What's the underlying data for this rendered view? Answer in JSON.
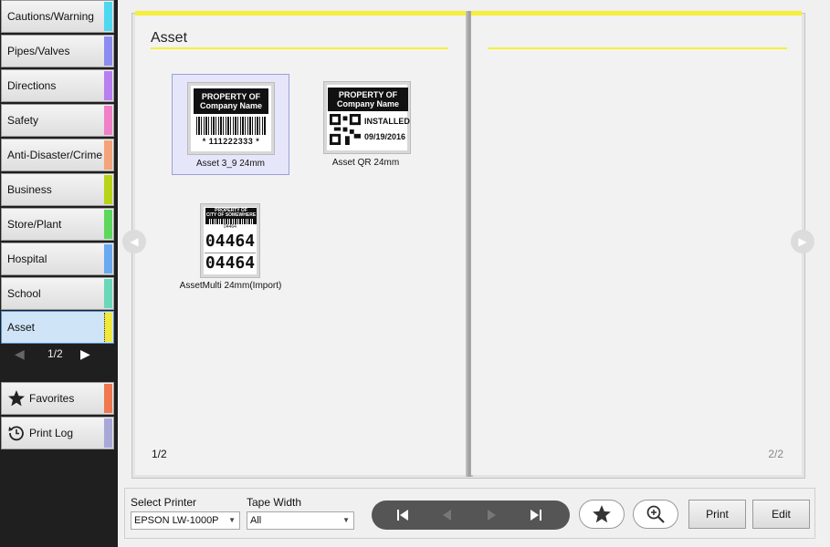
{
  "sidebar": {
    "categories": [
      {
        "label": "Cautions/Warning",
        "color": "#4dd8f0"
      },
      {
        "label": "Pipes/Valves",
        "color": "#8c8cf0"
      },
      {
        "label": "Directions",
        "color": "#b87ff0"
      },
      {
        "label": "Safety",
        "color": "#f080c8"
      },
      {
        "label": "Anti-Disaster/Crime",
        "color": "#f4a47a"
      },
      {
        "label": "Business",
        "color": "#b8d418"
      },
      {
        "label": "Store/Plant",
        "color": "#5cd85c"
      },
      {
        "label": "Hospital",
        "color": "#6aa8f0"
      },
      {
        "label": "School",
        "color": "#6ad8b8"
      },
      {
        "label": "Asset",
        "color": "#f0e83a"
      }
    ],
    "pager": {
      "label": "1/2"
    },
    "favorites": {
      "label": "Favorites",
      "color": "#f07850",
      "icon": "star-icon"
    },
    "print_log": {
      "label": "Print Log",
      "color": "#a8a8d8",
      "icon": "history-icon"
    }
  },
  "book": {
    "left": {
      "title": "Asset",
      "page_num": "1/2",
      "items": [
        {
          "caption": "Asset 3_9 24mm",
          "lines": [
            "PROPERTY OF",
            "Company Name",
            "* 111222333 *"
          ]
        },
        {
          "caption": "Asset QR 24mm",
          "lines": [
            "PROPERTY OF",
            "Company Name",
            "INSTALLED",
            "09/19/2016"
          ]
        },
        {
          "caption": "AssetMulti 24mm(Import)",
          "lines": [
            "PROPERTY OF",
            "CITY OF SOMEWHERE",
            "04464",
            "04464",
            "04464"
          ]
        }
      ]
    },
    "right": {
      "page_num": "2/2"
    }
  },
  "bottom": {
    "printer_label": "Select Printer",
    "printer_value": "EPSON LW-1000P",
    "tape_label": "Tape Width",
    "tape_value": "All",
    "print_label": "Print",
    "edit_label": "Edit"
  },
  "colors": {
    "accent_yellow": "#f5ef3a",
    "sidebar_bg": "#1f1f1f"
  }
}
